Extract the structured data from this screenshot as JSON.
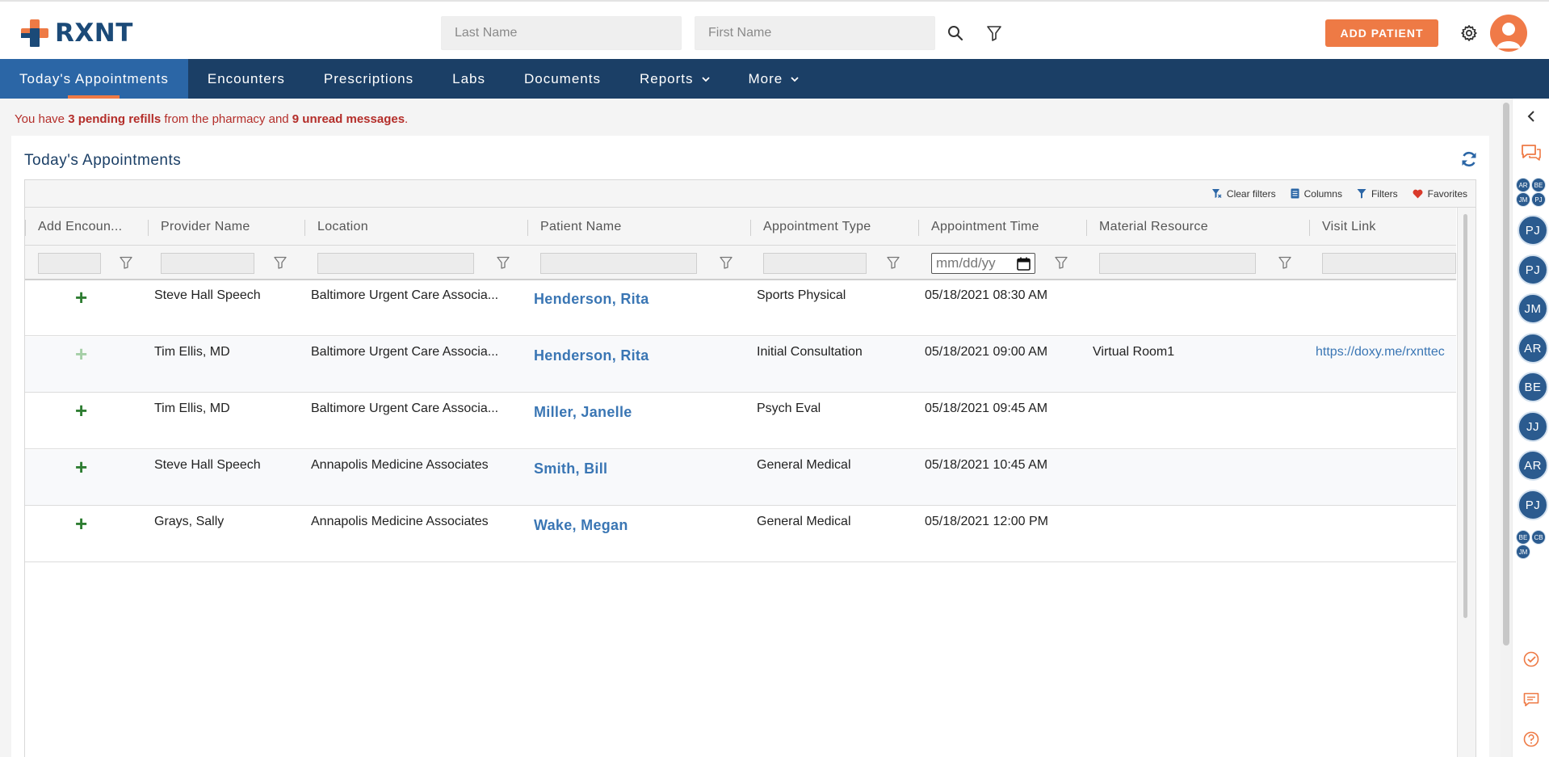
{
  "header": {
    "logo_text": "RXNT",
    "last_name_placeholder": "Last Name",
    "first_name_placeholder": "First Name",
    "add_patient_label": "ADD PATIENT",
    "brand_orange": "#ee7a45",
    "brand_navy": "#1b3f66"
  },
  "nav": {
    "items": [
      {
        "label": "Today's Appointments",
        "active": true
      },
      {
        "label": "Encounters"
      },
      {
        "label": "Prescriptions"
      },
      {
        "label": "Labs"
      },
      {
        "label": "Documents"
      },
      {
        "label": "Reports",
        "dropdown": true
      },
      {
        "label": "More",
        "dropdown": true
      }
    ]
  },
  "notice": {
    "prefix": "You have ",
    "refills": "3 pending refills",
    "middle": " from the pharmacy and ",
    "messages": "9 unread messages",
    "suffix": "."
  },
  "panel": {
    "title": "Today's Appointments"
  },
  "toolbar": {
    "clear_filters": "Clear filters",
    "columns": "Columns",
    "filters": "Filters",
    "favorites": "Favorites"
  },
  "table": {
    "columns": [
      "Add Encoun...",
      "Provider Name",
      "Location",
      "Patient Name",
      "Appointment Type",
      "Appointment Time",
      "Material Resource",
      "Visit Link"
    ],
    "date_placeholder": "mm/dd/yy",
    "rows": [
      {
        "add_enabled": true,
        "provider": "Steve Hall Speech",
        "location": "Baltimore Urgent Care Associa...",
        "patient": "Henderson, Rita",
        "type": "Sports Physical",
        "time": "05/18/2021 08:30 AM",
        "resource": "",
        "link": ""
      },
      {
        "add_enabled": false,
        "provider": "Tim Ellis, MD",
        "location": "Baltimore Urgent Care Associa...",
        "patient": "Henderson, Rita",
        "type": "Initial Consultation",
        "time": "05/18/2021 09:00 AM",
        "resource": "Virtual Room1",
        "link": "https://doxy.me/rxnttec"
      },
      {
        "add_enabled": true,
        "provider": "Tim Ellis, MD",
        "location": "Baltimore Urgent Care Associa...",
        "patient": "Miller, Janelle",
        "type": "Psych Eval",
        "time": "05/18/2021 09:45 AM",
        "resource": "",
        "link": ""
      },
      {
        "add_enabled": true,
        "provider": "Steve Hall Speech",
        "location": "Annapolis Medicine Associates",
        "patient": "Smith, Bill",
        "type": "General Medical",
        "time": "05/18/2021 10:45 AM",
        "resource": "",
        "link": ""
      },
      {
        "add_enabled": true,
        "provider": "Grays, Sally",
        "location": "Annapolis Medicine Associates",
        "patient": "Wake, Megan",
        "type": "General Medical",
        "time": "05/18/2021 12:00 PM",
        "resource": "",
        "link": ""
      }
    ]
  },
  "rail": {
    "group_top": [
      "AR",
      "BE",
      "JM",
      "PJ"
    ],
    "avatars": [
      "PJ",
      "PJ",
      "JM",
      "AR",
      "BE",
      "JJ",
      "AR",
      "PJ"
    ],
    "group_bottom": [
      "BE",
      "CB",
      "JM"
    ]
  }
}
